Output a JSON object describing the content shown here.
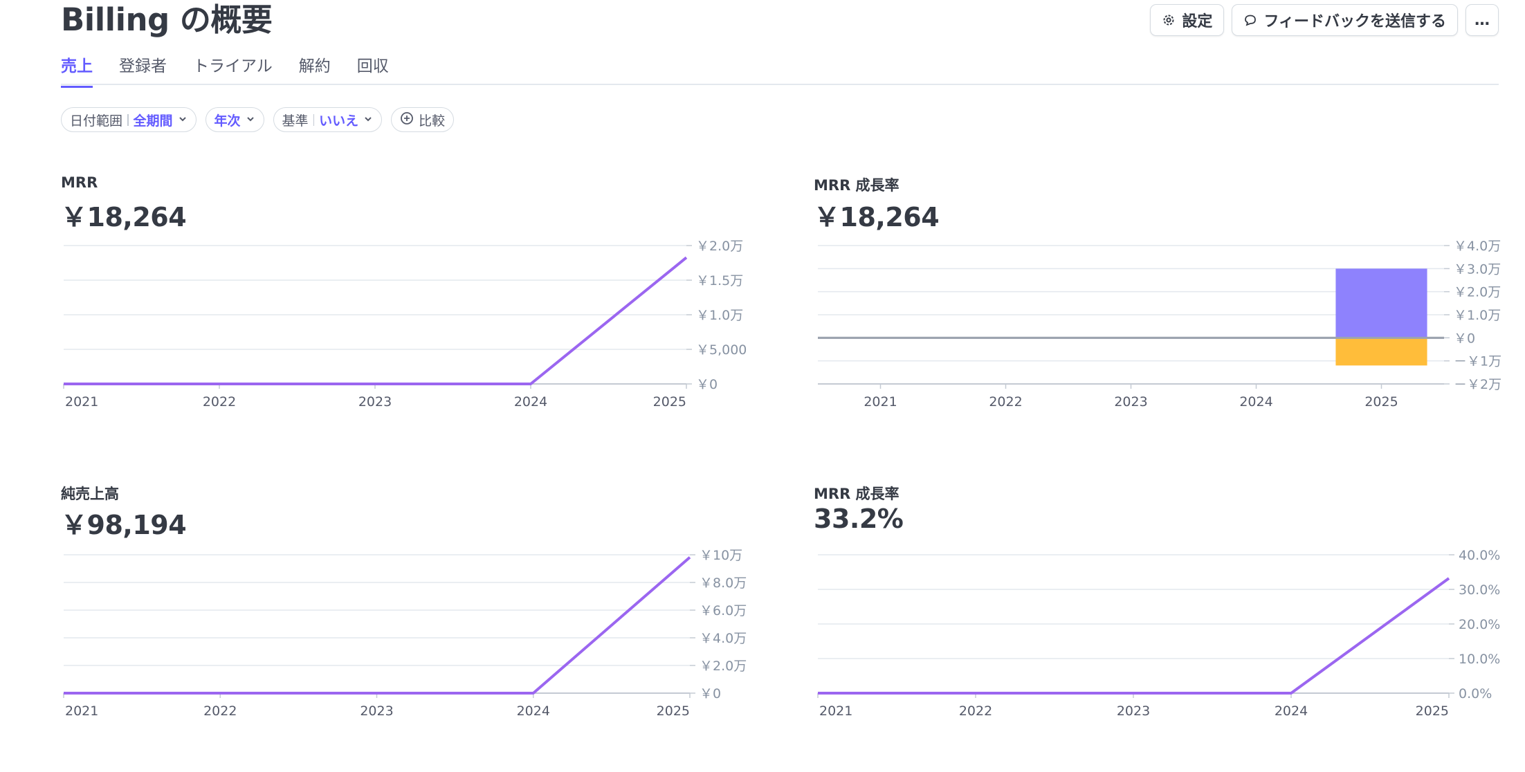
{
  "title": "Billing の概要",
  "actions": {
    "settings_label": "設定",
    "feedback_label": "フィードバックを送信する",
    "more_label": "…"
  },
  "tabs": [
    {
      "label": "売上",
      "active": true
    },
    {
      "label": "登録者",
      "active": false
    },
    {
      "label": "トライアル",
      "active": false
    },
    {
      "label": "解約",
      "active": false
    },
    {
      "label": "回収",
      "active": false
    }
  ],
  "filters": {
    "date_range_label": "日付範囲",
    "date_range_value": "全期間",
    "interval_value": "年次",
    "basis_label": "基準",
    "basis_value": "いいえ",
    "compare_label": "比較"
  },
  "colors": {
    "accent": "#635bff",
    "line": "#9b66f0",
    "bar_positive": "#8e82fd",
    "bar_negative": "#ffbd3a"
  },
  "metrics": {
    "mrr": {
      "label": "MRR",
      "value": "￥18,264"
    },
    "mrr_growth": {
      "label": "MRR 成長率",
      "value": "￥18,264"
    },
    "net_revenue": {
      "label": "純売上高",
      "value": "￥98,194"
    },
    "mrr_growth_rate": {
      "label": "MRR 成長率",
      "value": "33.2%"
    }
  },
  "chart_data": [
    {
      "type": "line",
      "x": [
        "2021",
        "2022",
        "2023",
        "2024",
        "2025"
      ],
      "series": [
        {
          "values": [
            0,
            0,
            0,
            0,
            18264
          ]
        }
      ],
      "ylim": [
        0,
        20000
      ],
      "yticks": [
        0,
        5000,
        10000,
        15000,
        20000
      ],
      "ytick_labels": [
        "￥0",
        "￥5,000",
        "￥1.0万",
        "￥1.5万",
        "￥2.0万"
      ],
      "grid": true
    },
    {
      "type": "bar",
      "categories": [
        "2021",
        "2022",
        "2023",
        "2024",
        "2025"
      ],
      "series": [
        {
          "values": [
            0,
            0,
            0,
            0,
            30000
          ]
        },
        {
          "values": [
            0,
            0,
            0,
            0,
            -12000
          ]
        }
      ],
      "ylim": [
        -20000,
        40000
      ],
      "yticks": [
        -20000,
        -10000,
        0,
        10000,
        20000,
        30000,
        40000
      ],
      "ytick_labels": [
        "－￥2万",
        "－￥1万",
        "￥0",
        "￥1.0万",
        "￥2.0万",
        "￥3.0万",
        "￥4.0万"
      ],
      "grid": true
    },
    {
      "type": "line",
      "x": [
        "2021",
        "2022",
        "2023",
        "2024",
        "2025"
      ],
      "series": [
        {
          "values": [
            0,
            0,
            0,
            0,
            98194
          ]
        }
      ],
      "ylim": [
        0,
        100000
      ],
      "yticks": [
        0,
        20000,
        40000,
        60000,
        80000,
        100000
      ],
      "ytick_labels": [
        "￥0",
        "￥2.0万",
        "￥4.0万",
        "￥6.0万",
        "￥8.0万",
        "￥10万"
      ],
      "grid": true
    },
    {
      "type": "line",
      "x": [
        "2021",
        "2022",
        "2023",
        "2024",
        "2025"
      ],
      "series": [
        {
          "values": [
            0,
            0,
            0,
            0,
            33.2
          ]
        }
      ],
      "ylim": [
        0,
        40
      ],
      "yticks": [
        0,
        10,
        20,
        30,
        40
      ],
      "ytick_labels": [
        "0.0%",
        "10.0%",
        "20.0%",
        "30.0%",
        "40.0%"
      ],
      "grid": true
    }
  ]
}
